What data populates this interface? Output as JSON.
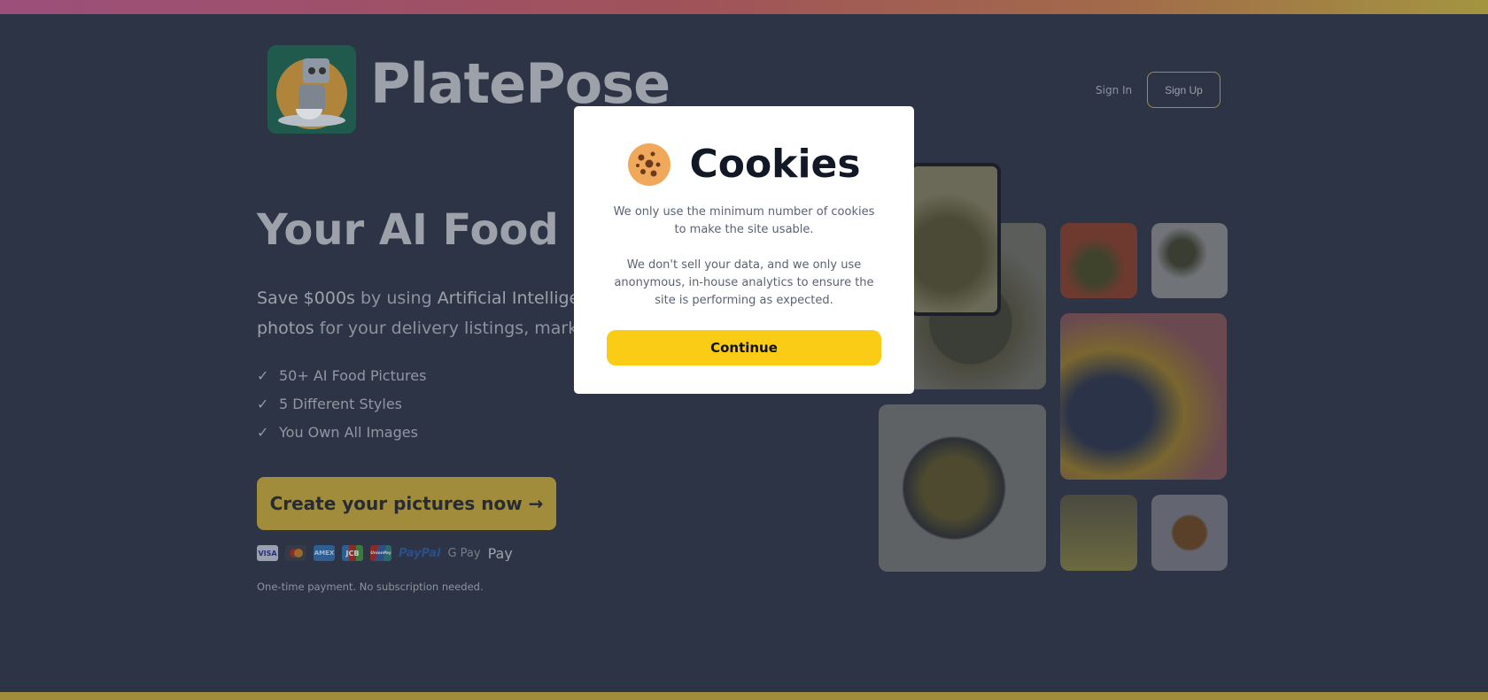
{
  "brand": {
    "name": "PlatePose"
  },
  "nav": {
    "sign_in": "Sign In",
    "sign_up": "Sign Up"
  },
  "hero": {
    "headline": "Your AI Food St",
    "sub_line1_bold1": "Save $000s",
    "sub_line1_text": " by using ",
    "sub_line1_bold2": "Artificial Intelligence",
    "sub_line2_bold": "photos",
    "sub_line2_text": " for your delivery listings, marketing",
    "features": [
      "50+ AI Food Pictures",
      "5 Different Styles",
      "You Own All Images"
    ],
    "check_glyph": "✓",
    "cta": "Create your pictures now →",
    "payment_methods": [
      "VISA",
      "Mastercard",
      "AMEX",
      "JCB",
      "UnionPay",
      "PayPal",
      "G Pay",
      " Pay"
    ],
    "note": "One-time payment. No subscription needed."
  },
  "cookie_modal": {
    "icon": "cookie-icon",
    "title": "Cookies",
    "para1": "We only use the minimum number of cookies to make the site usable.",
    "para2": "We don't sell your data, and we only use anonymous, in-house analytics to ensure the site is performing as expected.",
    "button": "Continue"
  },
  "colors": {
    "accent": "#facc15",
    "background": "#2d3446",
    "dimmed_accent": "#a08c3a"
  }
}
